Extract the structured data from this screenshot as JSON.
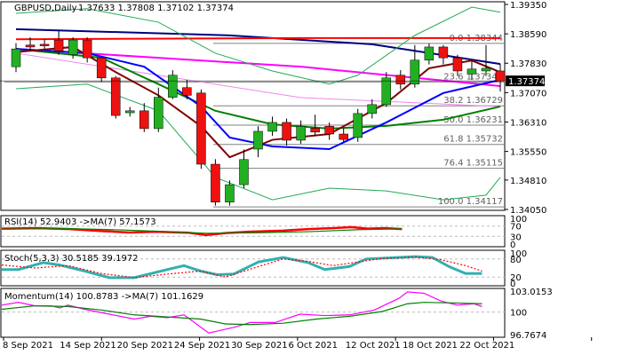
{
  "header": {
    "symbol": "GBPUSD,Daily",
    "ohlc": "1.37633 1.37808 1.37102 1.37374"
  },
  "chart_data": [
    {
      "type": "candlestick",
      "title": "GBPUSD,Daily",
      "ylim": [
        1.3405,
        1.3935
      ],
      "yticks": [
        "1.39350",
        "1.38590",
        "1.37830",
        "1.37070",
        "1.36310",
        "1.35550",
        "1.34810",
        "1.34050"
      ],
      "ytick_values": [
        1.3935,
        1.3859,
        1.3783,
        1.3707,
        1.3631,
        1.3555,
        1.3481,
        1.3405
      ],
      "current_price": "1.37374",
      "current_value": 1.37374,
      "xlabels": [
        "8 Sep 2021",
        "14 Sep 2021",
        "20 Sep 2021",
        "24 Sep 2021",
        "30 Sep 2021",
        "6 Oct 2021",
        "12 Oct 2021",
        "18 Oct 2021",
        "22 Oct 2021"
      ],
      "xlabel_index": [
        0,
        4,
        8,
        12,
        16,
        20,
        24,
        28,
        32
      ],
      "candles": [
        [
          1.3774,
          1.3835,
          1.376,
          1.382
        ],
        [
          1.383,
          1.385,
          1.3815,
          1.3825
        ],
        [
          1.3832,
          1.3845,
          1.382,
          1.3828
        ],
        [
          1.3843,
          1.387,
          1.3805,
          1.3815
        ],
        [
          1.3805,
          1.385,
          1.3795,
          1.3843
        ],
        [
          1.3843,
          1.385,
          1.3785,
          1.3797
        ],
        [
          1.3797,
          1.38,
          1.3735,
          1.3745
        ],
        [
          1.3745,
          1.375,
          1.364,
          1.3648
        ],
        [
          1.3655,
          1.367,
          1.3645,
          1.366
        ],
        [
          1.366,
          1.368,
          1.3605,
          1.3614
        ],
        [
          1.3614,
          1.372,
          1.3605,
          1.3695
        ],
        [
          1.3695,
          1.3765,
          1.369,
          1.3752
        ],
        [
          1.372,
          1.374,
          1.369,
          1.37
        ],
        [
          1.3706,
          1.3715,
          1.351,
          1.3522
        ],
        [
          1.3522,
          1.3535,
          1.3415,
          1.3424
        ],
        [
          1.3424,
          1.348,
          1.3415,
          1.3469
        ],
        [
          1.3469,
          1.356,
          1.346,
          1.3534
        ],
        [
          1.3561,
          1.362,
          1.354,
          1.3607
        ],
        [
          1.3607,
          1.3645,
          1.3595,
          1.363
        ],
        [
          1.363,
          1.364,
          1.357,
          1.3584
        ],
        [
          1.3584,
          1.3635,
          1.3575,
          1.362
        ],
        [
          1.3615,
          1.365,
          1.3595,
          1.3605
        ],
        [
          1.362,
          1.363,
          1.3585,
          1.36
        ],
        [
          1.36,
          1.3615,
          1.358,
          1.3586
        ],
        [
          1.3591,
          1.3665,
          1.358,
          1.3653
        ],
        [
          1.3653,
          1.369,
          1.364,
          1.3676
        ],
        [
          1.3676,
          1.376,
          1.367,
          1.3745
        ],
        [
          1.3752,
          1.3765,
          1.3715,
          1.3729
        ],
        [
          1.3729,
          1.383,
          1.372,
          1.3791
        ],
        [
          1.3791,
          1.3834,
          1.378,
          1.3825
        ],
        [
          1.3825,
          1.383,
          1.378,
          1.3797
        ],
        [
          1.3797,
          1.3805,
          1.375,
          1.3763
        ],
        [
          1.3755,
          1.379,
          1.374,
          1.3768
        ],
        [
          1.3763,
          1.383,
          1.375,
          1.377
        ],
        [
          1.3763,
          1.3781,
          1.371,
          1.3737
        ]
      ],
      "lines": [
        {
          "name": "ma-navy",
          "color": "#000080",
          "width": 2,
          "points": [
            [
              0,
              1.3871
            ],
            [
              15,
              1.3855
            ],
            [
              25,
              1.3832
            ],
            [
              34,
              1.3781
            ]
          ]
        },
        {
          "name": "ma-red",
          "color": "#ff0000",
          "width": 2,
          "points": [
            [
              0,
              1.3845
            ],
            [
              20,
              1.3848
            ],
            [
              34,
              1.3848
            ]
          ]
        },
        {
          "name": "ma-magenta",
          "color": "#ff00ff",
          "width": 2,
          "points": [
            [
              0,
              1.382
            ],
            [
              10,
              1.3797
            ],
            [
              20,
              1.3774
            ],
            [
              34,
              1.3724
            ]
          ]
        },
        {
          "name": "ma-pink",
          "color": "#ee88ee",
          "width": 1,
          "points": [
            [
              0,
              1.3809
            ],
            [
              10,
              1.3752
            ],
            [
              20,
              1.3694
            ],
            [
              34,
              1.3671
            ]
          ]
        },
        {
          "name": "ma-green",
          "color": "#008000",
          "width": 2,
          "points": [
            [
              0,
              1.382
            ],
            [
              6,
              1.3797
            ],
            [
              10,
              1.3729
            ],
            [
              14,
              1.366
            ],
            [
              18,
              1.3625
            ],
            [
              22,
              1.3614
            ],
            [
              26,
              1.3621
            ],
            [
              30,
              1.3637
            ],
            [
              34,
              1.3671
            ]
          ]
        },
        {
          "name": "ma-blue",
          "color": "#0000ff",
          "width": 2,
          "points": [
            [
              0,
              1.382
            ],
            [
              5,
              1.3809
            ],
            [
              9,
              1.3774
            ],
            [
              13,
              1.3671
            ],
            [
              15,
              1.3591
            ],
            [
              18,
              1.3568
            ],
            [
              22,
              1.3561
            ],
            [
              26,
              1.363
            ],
            [
              30,
              1.3706
            ],
            [
              34,
              1.374
            ]
          ]
        },
        {
          "name": "ma-darkred",
          "color": "#800000",
          "width": 2,
          "points": [
            [
              0,
              1.3812
            ],
            [
              4,
              1.3825
            ],
            [
              7,
              1.376
            ],
            [
              10,
              1.37
            ],
            [
              13,
              1.362
            ],
            [
              15,
              1.354
            ],
            [
              18,
              1.3585
            ],
            [
              22,
              1.36
            ],
            [
              26,
              1.368
            ],
            [
              29,
              1.377
            ],
            [
              32,
              1.379
            ],
            [
              34,
              1.376
            ]
          ]
        },
        {
          "name": "bollinger-upper",
          "color": "#22aa55",
          "width": 1,
          "points": [
            [
              0,
              1.3912
            ],
            [
              5,
              1.3924
            ],
            [
              10,
              1.3889
            ],
            [
              14,
              1.3809
            ],
            [
              18,
              1.3763
            ],
            [
              22,
              1.3729
            ],
            [
              24,
              1.3752
            ],
            [
              28,
              1.3855
            ],
            [
              32,
              1.3928
            ],
            [
              34,
              1.3915
            ]
          ]
        },
        {
          "name": "bollinger-lower",
          "color": "#22aa55",
          "width": 1,
          "points": [
            [
              0,
              1.3717
            ],
            [
              5,
              1.3729
            ],
            [
              10,
              1.366
            ],
            [
              14,
              1.3488
            ],
            [
              18,
              1.343
            ],
            [
              22,
              1.346
            ],
            [
              26,
              1.3453
            ],
            [
              30,
              1.343
            ],
            [
              33,
              1.3442
            ],
            [
              34,
              1.3488
            ]
          ]
        }
      ],
      "fibonacci": [
        {
          "label": "0.0 1.38344",
          "value": 1.38344
        },
        {
          "label": "23.6 1.37346",
          "value": 1.37346
        },
        {
          "label": "38.2 1.36729",
          "value": 1.36729
        },
        {
          "label": "50.0 1.36231",
          "value": 1.36231
        },
        {
          "label": "61.8 1.35732",
          "value": 1.35732
        },
        {
          "label": "76.4 1.35115",
          "value": 1.35115
        },
        {
          "label": "100.0 1.34117",
          "value": 1.34117
        }
      ]
    },
    {
      "type": "line",
      "title": "RSI(14) 52.9403  ->MA(7) 57.1573",
      "ylim": [
        0,
        100
      ],
      "yticks": [
        "100",
        "70",
        "30",
        "0"
      ],
      "ytick_values": [
        100,
        70,
        30,
        0
      ],
      "levels": [
        70,
        30
      ],
      "series": [
        {
          "name": "rsi",
          "color": "#ff0000",
          "points": [
            [
              0,
              60
            ],
            [
              4,
              62
            ],
            [
              8,
              58
            ],
            [
              12,
              50
            ],
            [
              15,
              45
            ],
            [
              18,
              48
            ],
            [
              22,
              44
            ],
            [
              24,
              35
            ],
            [
              26,
              42
            ],
            [
              29,
              48
            ],
            [
              33,
              52
            ],
            [
              36,
              58
            ],
            [
              39,
              62
            ],
            [
              41,
              66
            ],
            [
              43,
              60
            ],
            [
              45,
              62
            ],
            [
              47,
              58
            ]
          ]
        },
        {
          "name": "rsi-ma",
          "color": "#008000",
          "points": [
            [
              0,
              58
            ],
            [
              8,
              60
            ],
            [
              14,
              55
            ],
            [
              18,
              50
            ],
            [
              24,
              42
            ],
            [
              30,
              44
            ],
            [
              36,
              48
            ],
            [
              42,
              56
            ],
            [
              47,
              59
            ]
          ]
        }
      ]
    },
    {
      "type": "line",
      "title": "Stoch(5,3,3) 30.5185 39.1972",
      "ylim": [
        0,
        100
      ],
      "yticks": [
        "100",
        "80",
        "20",
        "0"
      ],
      "ytick_values": [
        100,
        80,
        20,
        0
      ],
      "levels": [
        80,
        20
      ],
      "series": [
        {
          "name": "stoch-main",
          "color": "#30b0b0",
          "points": [
            [
              0,
              45
            ],
            [
              2,
              45
            ],
            [
              5,
              68
            ],
            [
              7,
              60
            ],
            [
              10,
              40
            ],
            [
              13,
              18
            ],
            [
              16,
              18
            ],
            [
              20,
              45
            ],
            [
              22,
              58
            ],
            [
              24,
              40
            ],
            [
              26,
              28
            ],
            [
              28,
              30
            ],
            [
              31,
              70
            ],
            [
              34,
              85
            ],
            [
              37,
              68
            ],
            [
              39,
              45
            ],
            [
              42,
              55
            ],
            [
              44,
              80
            ],
            [
              47,
              84
            ],
            [
              50,
              88
            ],
            [
              52,
              85
            ],
            [
              54,
              55
            ],
            [
              56,
              32
            ],
            [
              58,
              32
            ]
          ]
        },
        {
          "name": "stoch-signal",
          "color": "#ff0000",
          "dashed": true,
          "points": [
            [
              0,
              60
            ],
            [
              4,
              50
            ],
            [
              8,
              58
            ],
            [
              12,
              32
            ],
            [
              16,
              18
            ],
            [
              20,
              30
            ],
            [
              24,
              40
            ],
            [
              27,
              20
            ],
            [
              31,
              55
            ],
            [
              34,
              80
            ],
            [
              37,
              72
            ],
            [
              40,
              58
            ],
            [
              43,
              70
            ],
            [
              46,
              82
            ],
            [
              50,
              86
            ],
            [
              53,
              78
            ],
            [
              56,
              58
            ],
            [
              58,
              40
            ]
          ]
        }
      ]
    },
    {
      "type": "line",
      "title": "Momentum(14) 100.8783  ->MA(7) 101.1629",
      "ylim": [
        96.7674,
        103.0153
      ],
      "yticks": [
        "103.0153",
        "100",
        "96.7674"
      ],
      "ytick_values": [
        103.0153,
        100,
        96.7674
      ],
      "levels": [
        100
      ],
      "series": [
        {
          "name": "momentum",
          "color": "#ff00ff",
          "points": [
            [
              0,
              101.0
            ],
            [
              2,
              101.4
            ],
            [
              4,
              100.9
            ],
            [
              6,
              100.9
            ],
            [
              7,
              100.6
            ],
            [
              8,
              101.0
            ],
            [
              10,
              100.4
            ],
            [
              13,
              99.7
            ],
            [
              16,
              99.0
            ],
            [
              18,
              99.4
            ],
            [
              20,
              99.2
            ],
            [
              22,
              99.6
            ],
            [
              25,
              97.0
            ],
            [
              28,
              97.8
            ],
            [
              30,
              98.5
            ],
            [
              33,
              98.5
            ],
            [
              36,
              99.7
            ],
            [
              39,
              99.5
            ],
            [
              42,
              99.6
            ],
            [
              45,
              100.3
            ],
            [
              48,
              102.0
            ],
            [
              49,
              102.9
            ],
            [
              51,
              102.7
            ],
            [
              53,
              101.6
            ],
            [
              55,
              101.0
            ],
            [
              57,
              101.2
            ],
            [
              58,
              100.8
            ]
          ]
        },
        {
          "name": "momentum-ma",
          "color": "#008000",
          "points": [
            [
              0,
              100.4
            ],
            [
              4,
              100.9
            ],
            [
              8,
              100.8
            ],
            [
              12,
              100.3
            ],
            [
              16,
              99.6
            ],
            [
              20,
              99.3
            ],
            [
              24,
              99.0
            ],
            [
              27,
              98.3
            ],
            [
              30,
              98.2
            ],
            [
              34,
              98.4
            ],
            [
              38,
              99.0
            ],
            [
              42,
              99.4
            ],
            [
              46,
              100.1
            ],
            [
              49,
              101.2
            ],
            [
              51,
              101.4
            ],
            [
              55,
              101.3
            ],
            [
              58,
              101.2
            ]
          ]
        }
      ]
    }
  ]
}
